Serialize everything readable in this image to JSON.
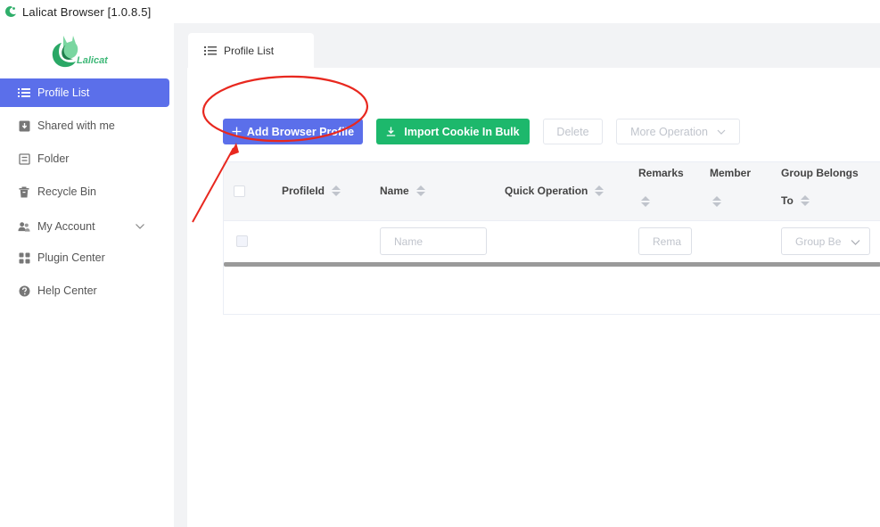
{
  "window": {
    "title": "Lalicat Browser  [1.0.8.5]"
  },
  "brand": {
    "logo_text": "Lalicat",
    "color": "#3fb878"
  },
  "sidebar": {
    "items": [
      {
        "label": "Profile List",
        "icon": "list-icon",
        "active": true
      },
      {
        "label": "Shared with me",
        "icon": "download-box-icon"
      },
      {
        "label": "Folder",
        "icon": "folder-icon"
      },
      {
        "label": "Recycle Bin",
        "icon": "trash-icon"
      },
      {
        "label": "My Account",
        "icon": "users-icon",
        "expandable": true
      },
      {
        "label": "Plugin Center",
        "icon": "grid-icon"
      },
      {
        "label": "Help Center",
        "icon": "help-icon"
      }
    ]
  },
  "tabs": [
    {
      "label": "Profile List",
      "icon": "list-icon"
    }
  ],
  "toolbar": {
    "add_label": "Add Browser Profile",
    "import_label": "Import Cookie In Bulk",
    "delete_label": "Delete",
    "more_label": "More Operation"
  },
  "table": {
    "columns": {
      "profile_id": "ProfileId",
      "name": "Name",
      "quick_operation": "Quick Operation",
      "remarks": "Remarks",
      "member": "Member",
      "group_line1": "Group Belongs",
      "group_line2": "To"
    },
    "filters": {
      "name_placeholder": "Name",
      "remarks_placeholder": "Rema",
      "group_placeholder": "Group Be"
    }
  },
  "colors": {
    "primary": "#5B6FEA",
    "success": "#1DB86C",
    "annotation": "#e8281f"
  }
}
